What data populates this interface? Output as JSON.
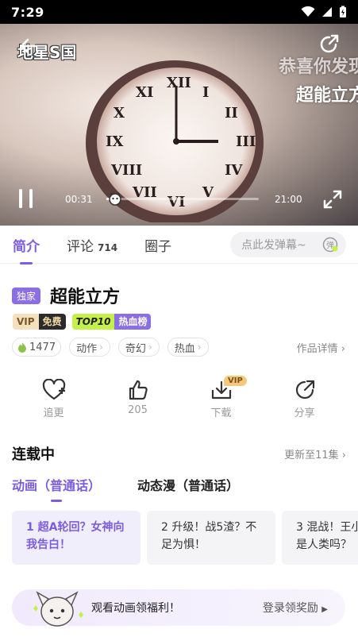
{
  "status_bar": {
    "time": "7:29"
  },
  "player": {
    "watermark": "地星S国",
    "overlay_line1": "恭喜你发现",
    "overlay_line2": "超能立方",
    "current_time": "00:31",
    "total_time": "21:00",
    "progress_percent": 2.5
  },
  "tabs": {
    "intro": "简介",
    "comments": "评论",
    "comments_count": "714",
    "circle": "圈子",
    "danmaku_placeholder": "点此发弹幕~"
  },
  "show": {
    "exclusive_badge": "独家",
    "title": "超能立方",
    "vip_label": "VIP",
    "free_label": "免费",
    "top_label": "TOP10",
    "hot_label": "热血榜",
    "heat": "1477",
    "tags": [
      "动作",
      "奇幻",
      "热血"
    ],
    "details_link": "作品详情"
  },
  "actions": {
    "follow": "追更",
    "likes": "205",
    "download": "下载",
    "download_vip": "VIP",
    "share": "分享"
  },
  "section": {
    "title": "连载中",
    "update": "更新至11集"
  },
  "sub_tabs": [
    "动画（普通话）",
    "动态漫（普通话）"
  ],
  "episodes": [
    {
      "line1": "1 超A轮回？女神向",
      "line2": "我告白！"
    },
    {
      "line1": "2 升级！战5渣？不",
      "line2": "足为惧！"
    },
    {
      "line1": "3 混战！王小",
      "line2": "是人类吗？"
    }
  ],
  "promo": {
    "text": "观看动画领福利！",
    "link": "登录领奖励"
  },
  "colors": {
    "accent": "#7c5ce0",
    "lime": "#c4f04a"
  }
}
